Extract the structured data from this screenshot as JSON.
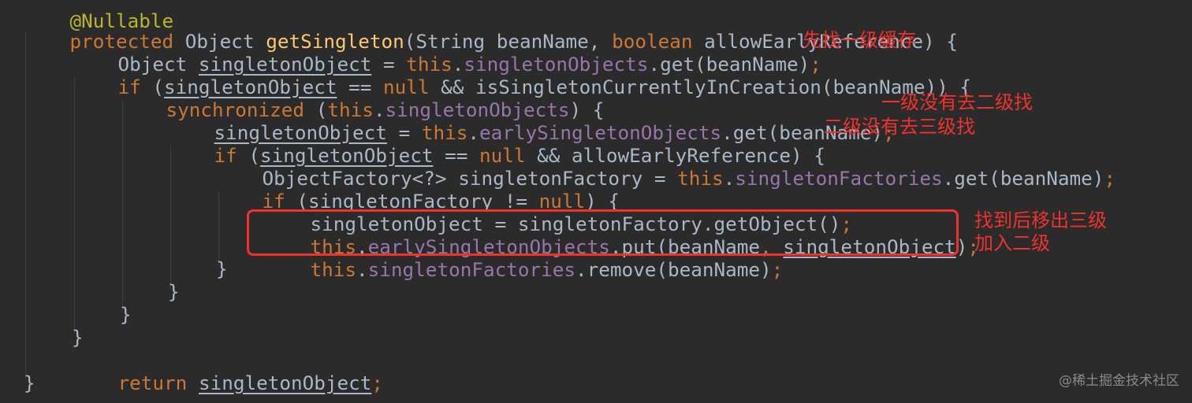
{
  "code": {
    "line0_annotation": "@Nullable",
    "line1": {
      "kw1": "protected",
      "t1": " Object ",
      "fn": "getSingleton",
      "t2": "(String beanName, ",
      "kw2": "boolean",
      "t3": " allowEarlyReference) {"
    },
    "line2": {
      "t1": "Object ",
      "var": "singletonObject",
      "t2": " = ",
      "kw": "this",
      "t3": ".",
      "field": "singletonObjects",
      "t4": ".get(beanName)",
      "semi": ";"
    },
    "line3": {
      "kw1": "if",
      "t1": " (",
      "var": "singletonObject",
      "t2": " == ",
      "kw2": "null",
      "t3": " && isSingletonCurrentlyInCreation(beanName)) {"
    },
    "line4": {
      "kw1": "synchronized",
      "t1": " (",
      "kw2": "this",
      "t2": ".",
      "field": "singletonObjects",
      "t3": ") {"
    },
    "line5": {
      "var": "singletonObject",
      "t1": " = ",
      "kw": "this",
      "t2": ".",
      "field": "earlySingletonObjects",
      "t3": ".get(beanName)",
      "semi": ";"
    },
    "line6": {
      "kw1": "if",
      "t1": " (",
      "var": "singletonObject",
      "t2": " == ",
      "kw2": "null",
      "t3": " && allowEarlyReference) {"
    },
    "line7": {
      "t1": "ObjectFactory<?> singletonFactory = ",
      "kw": "this",
      "t2": ".",
      "field": "singletonFactories",
      "t3": ".get(beanName)",
      "semi": ";"
    },
    "line8": {
      "kw1": "if",
      "t1": " (singletonFactory != ",
      "kw2": "null",
      "t2": ") {"
    },
    "line9": {
      "t1": "singletonObject = singletonFactory.getObject()",
      "semi": ";"
    },
    "line10": {
      "kw": "this",
      "t1": ".",
      "field": "earlySingletonObjects",
      "t2": ".put(beanName",
      "comma": ", ",
      "var": "singletonObject",
      "t3": ")",
      "semi": ";"
    },
    "line11": {
      "kw": "this",
      "t1": ".",
      "field": "singletonFactories",
      "t2": ".remove(beanName)",
      "semi": ";"
    },
    "close_brace": "}",
    "line16": {
      "kw": "return",
      "t1": " ",
      "var": "singletonObject",
      "semi": ";"
    }
  },
  "notes": {
    "first_level": "先找一级缓存",
    "second_level": "一级没有去二级找",
    "third_level": "二级没有去三级找",
    "move_line1": "找到后移出三级",
    "move_line2": "加入二级"
  },
  "watermark": "@稀土掘金技术社区",
  "colors": {
    "background": "#2b2b2b",
    "keyword": "#cc7832",
    "method": "#ffc66d",
    "field": "#9876aa",
    "text": "#a9b7c6",
    "annotation": "#bbb529",
    "note_red": "#f0322d"
  }
}
